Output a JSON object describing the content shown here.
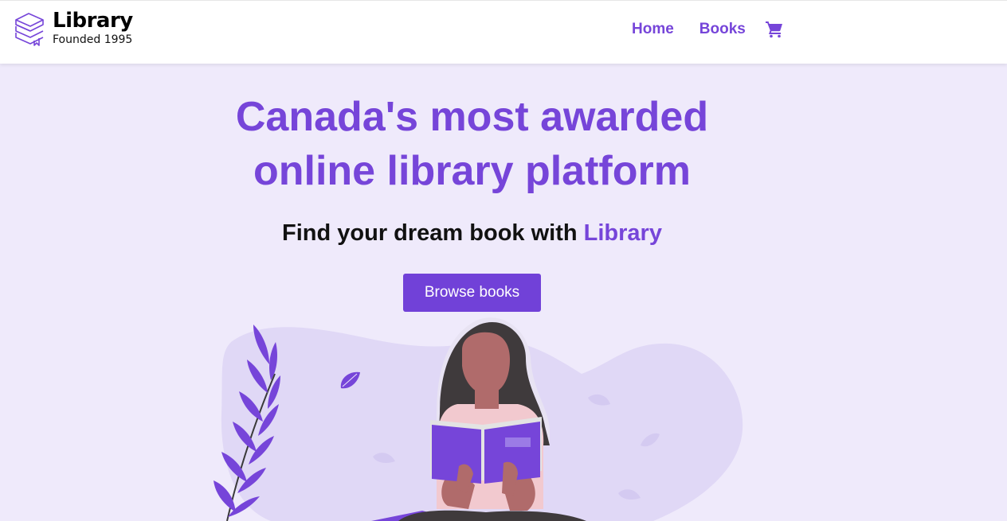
{
  "brand": {
    "name": "Library",
    "tagline": "Founded 1995"
  },
  "nav": {
    "links": [
      "Home",
      "Books"
    ],
    "cart_icon": "shopping-cart-icon"
  },
  "hero": {
    "title_line1": "Canada's most awarded",
    "title_line2": "online library platform",
    "subtitle_prefix": "Find your dream book with ",
    "subtitle_accent": "Library",
    "cta_label": "Browse books"
  },
  "colors": {
    "accent": "#7645d9",
    "button": "#7141d8",
    "background": "#efeafb",
    "blob": "#e0d8f6"
  }
}
